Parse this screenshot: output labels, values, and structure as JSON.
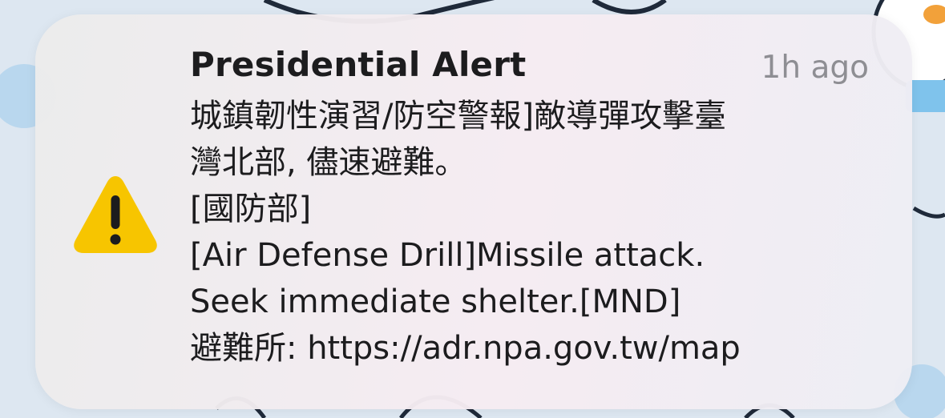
{
  "notification": {
    "title": "Presidential Alert",
    "timestamp": "1h ago",
    "icon": "warning-triangle-icon",
    "icon_color": "#F7C500",
    "lines": [
      "城鎮韌性演習/防空警報]敵導彈攻擊臺",
      "灣北部, 儘速避難。",
      "[國防部]",
      "[Air Defense Drill]Missile attack.",
      "Seek immediate shelter.[MND]",
      "避難所: https://adr.npa.gov.tw/map"
    ]
  }
}
